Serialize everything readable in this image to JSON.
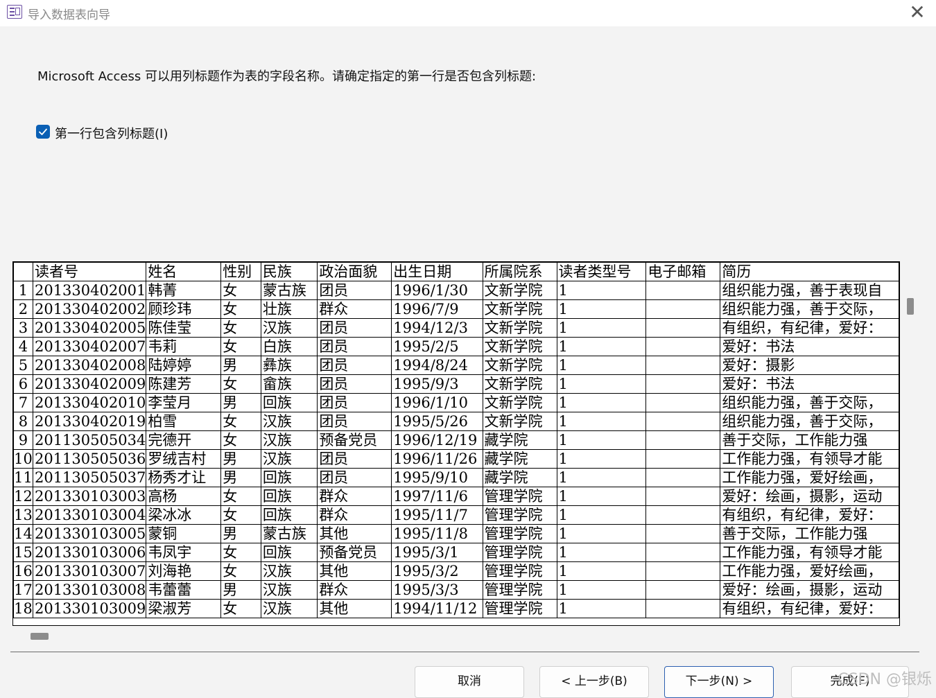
{
  "window": {
    "title": "导入数据表向导"
  },
  "description": "Microsoft Access 可以用列标题作为表的字段名称。请确定指定的第一行是否包含列标题:",
  "checkbox": {
    "label": "第一行包含列标题(I)",
    "checked": true
  },
  "grid": {
    "headers": [
      "读者号",
      "姓名",
      "性别",
      "民族",
      "政治面貌",
      "出生日期",
      "所属院系",
      "读者类型号",
      "电子邮箱",
      "简历"
    ],
    "rows": [
      [
        "1",
        "201330402001",
        "韩菁",
        "女",
        "蒙古族",
        "团员",
        "1996/1/30",
        "文新学院",
        "1",
        "",
        "组织能力强，善于表现自"
      ],
      [
        "2",
        "201330402002",
        "顾珍玮",
        "女",
        "壮族",
        "群众",
        "1996/7/9",
        "文新学院",
        "1",
        "",
        "组织能力强，善于交际，"
      ],
      [
        "3",
        "201330402005",
        "陈佳莹",
        "女",
        "汉族",
        "团员",
        "1994/12/3",
        "文新学院",
        "1",
        "",
        "有组织，有纪律，爱好："
      ],
      [
        "4",
        "201330402007",
        "韦莉",
        "女",
        "白族",
        "团员",
        "1995/2/5",
        "文新学院",
        "1",
        "",
        "爱好：书法"
      ],
      [
        "5",
        "201330402008",
        "陆婷婷",
        "男",
        "彝族",
        "团员",
        "1994/8/24",
        "文新学院",
        "1",
        "",
        "爱好：摄影"
      ],
      [
        "6",
        "201330402009",
        "陈建芳",
        "女",
        "畲族",
        "团员",
        "1995/9/3",
        "文新学院",
        "1",
        "",
        "爱好：书法"
      ],
      [
        "7",
        "201330402010",
        "李莹月",
        "男",
        "回族",
        "团员",
        "1996/1/10",
        "文新学院",
        "1",
        "",
        "组织能力强，善于交际，"
      ],
      [
        "8",
        "201330402019",
        "柏雪",
        "女",
        "汉族",
        "团员",
        "1995/5/26",
        "文新学院",
        "1",
        "",
        "组织能力强，善于交际，"
      ],
      [
        "9",
        "201130505034",
        "完德开",
        "女",
        "汉族",
        "预备党员",
        "1996/12/19",
        "藏学院",
        "1",
        "",
        "善于交际，工作能力强"
      ],
      [
        "10",
        "201130505036",
        "罗绒吉村",
        "男",
        "汉族",
        "团员",
        "1996/11/26",
        "藏学院",
        "1",
        "",
        "工作能力强，有领导才能"
      ],
      [
        "11",
        "201130505037",
        "杨秀才让",
        "男",
        "回族",
        "团员",
        "1995/9/10",
        "藏学院",
        "1",
        "",
        "工作能力强，爱好绘画，"
      ],
      [
        "12",
        "201330103003",
        "高杨",
        "女",
        "回族",
        "群众",
        "1997/11/6",
        "管理学院",
        "1",
        "",
        "爱好：绘画，摄影，运动"
      ],
      [
        "13",
        "201330103004",
        "梁冰冰",
        "女",
        "回族",
        "群众",
        "1995/11/7",
        "管理学院",
        "1",
        "",
        "有组织，有纪律，爱好："
      ],
      [
        "14",
        "201330103005",
        "蒙铜",
        "男",
        "蒙古族",
        "其他",
        "1995/11/8",
        "管理学院",
        "1",
        "",
        "善于交际，工作能力强"
      ],
      [
        "15",
        "201330103006",
        "韦凤宇",
        "女",
        "回族",
        "预备党员",
        "1995/3/1",
        "管理学院",
        "1",
        "",
        "工作能力强，有领导才能"
      ],
      [
        "16",
        "201330103007",
        "刘海艳",
        "女",
        "汉族",
        "其他",
        "1995/3/2",
        "管理学院",
        "1",
        "",
        "工作能力强，爱好绘画，"
      ],
      [
        "17",
        "201330103008",
        "韦蕾蕾",
        "男",
        "汉族",
        "群众",
        "1995/3/3",
        "管理学院",
        "1",
        "",
        "爱好：绘画，摄影，运动"
      ],
      [
        "18",
        "201330103009",
        "梁淑芳",
        "女",
        "汉族",
        "其他",
        "1994/11/12",
        "管理学院",
        "1",
        "",
        "有组织，有纪律，爱好："
      ]
    ]
  },
  "buttons": {
    "cancel": "取消",
    "back": "< 上一步(B)",
    "next": "下一步(N) >",
    "finish": "完成(F)"
  },
  "watermark": "CSDN @银烁",
  "colors": {
    "accent": "#0a5fb4",
    "title_text": "#8a8a8a"
  },
  "icons": {
    "app": "access-table-icon",
    "close": "close-icon",
    "check": "check-icon"
  }
}
